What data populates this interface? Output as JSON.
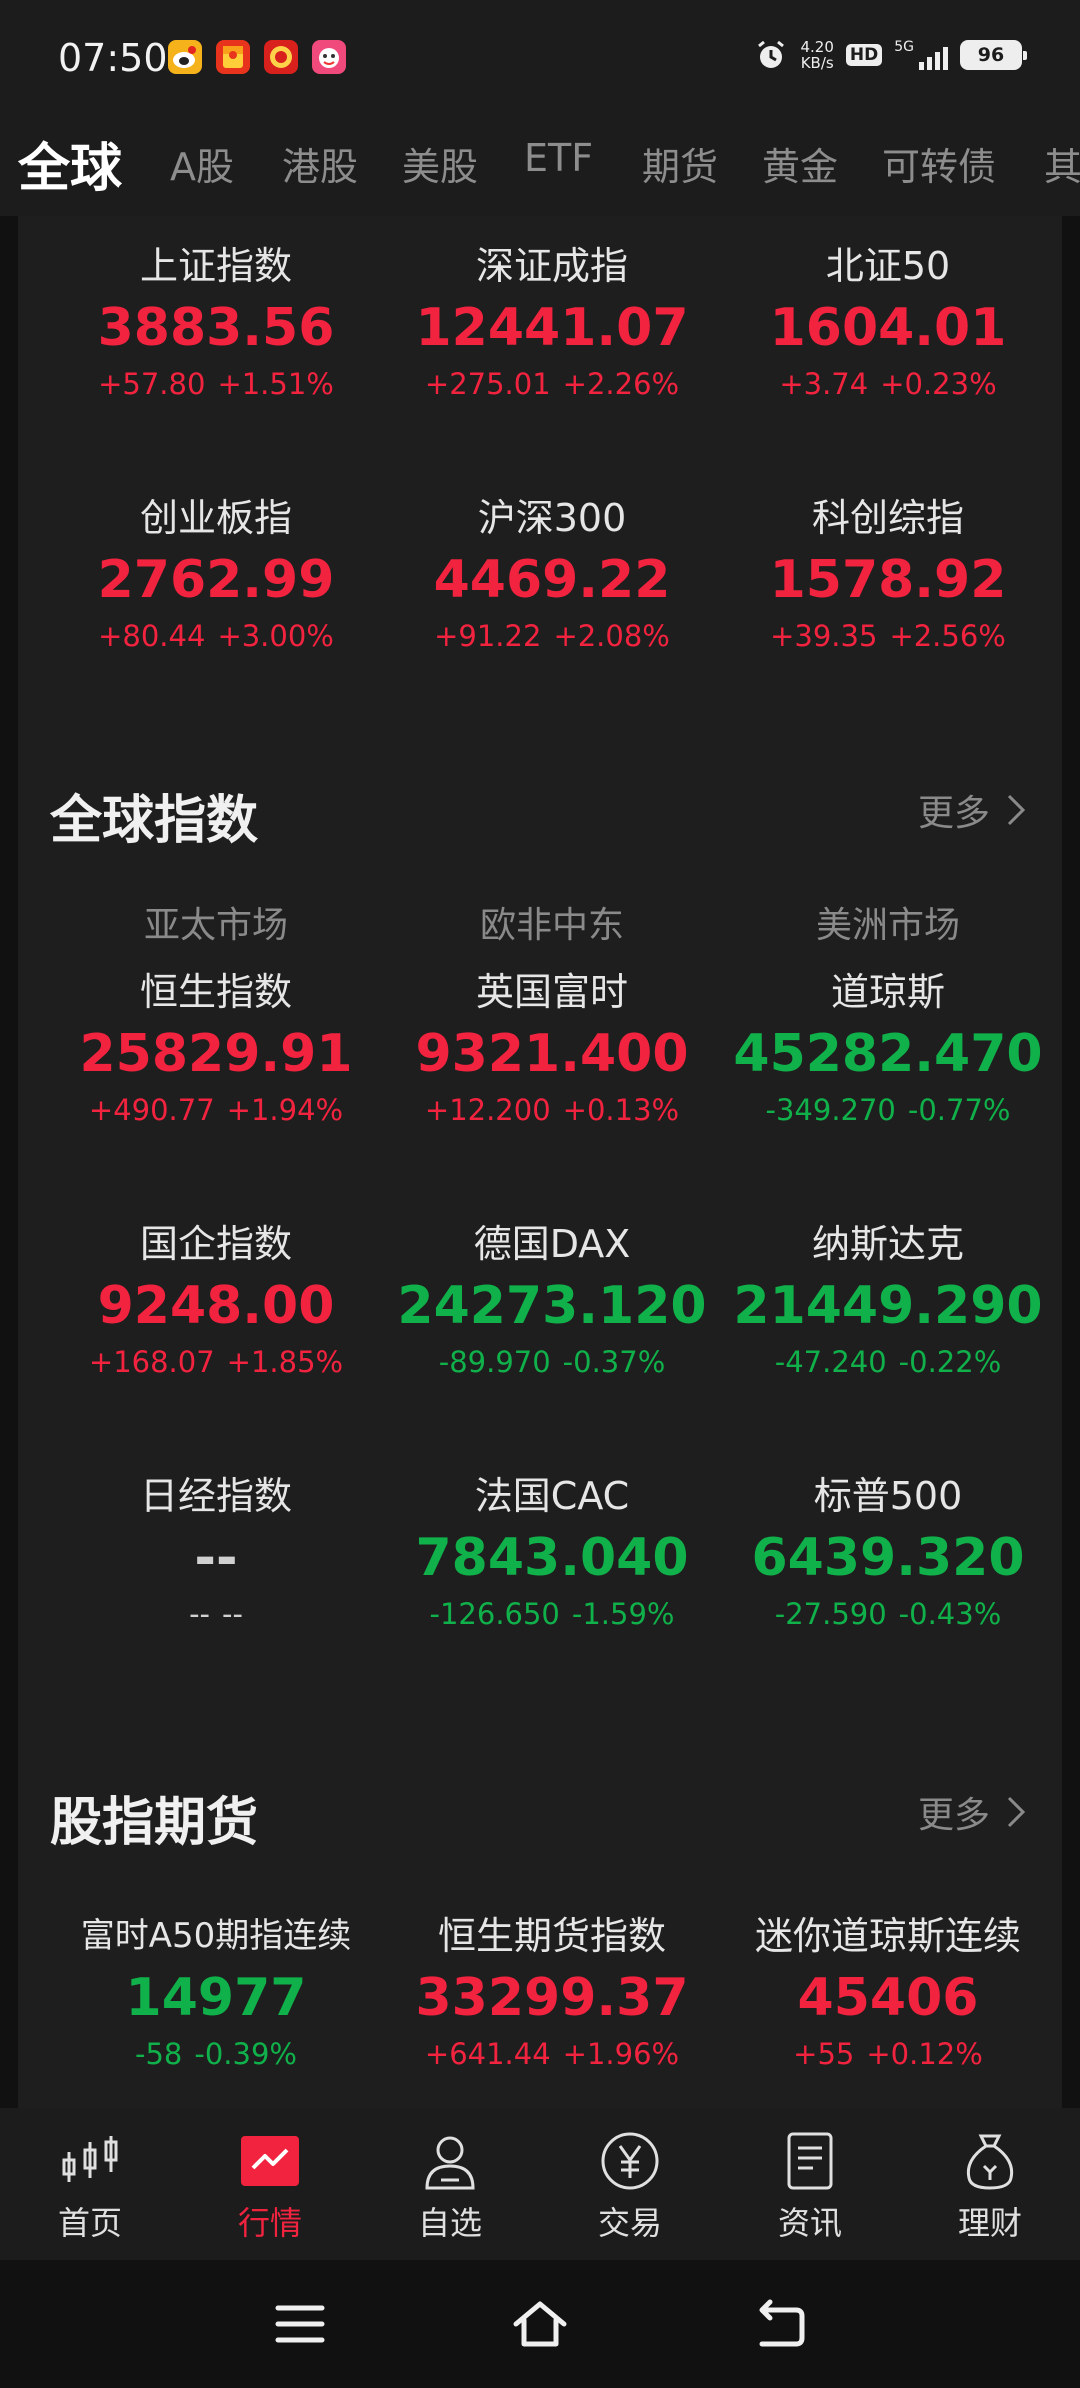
{
  "status_bar": {
    "time": "07:50",
    "net_speed_value": "4.20",
    "net_speed_unit": "KB/s",
    "hd": "HD",
    "network": "5G",
    "battery": "96"
  },
  "tabs": [
    "全球",
    "A股",
    "港股",
    "美股",
    "ETF",
    "期货",
    "黄金",
    "可转债",
    "其"
  ],
  "a_share_indices": [
    {
      "name": "上证指数",
      "price": "3883.56",
      "change": "+57.80",
      "pct": "+1.51%",
      "dir": "up"
    },
    {
      "name": "深证成指",
      "price": "12441.07",
      "change": "+275.01",
      "pct": "+2.26%",
      "dir": "up"
    },
    {
      "name": "北证50",
      "price": "1604.01",
      "change": "+3.74",
      "pct": "+0.23%",
      "dir": "up"
    },
    {
      "name": "创业板指",
      "price": "2762.99",
      "change": "+80.44",
      "pct": "+3.00%",
      "dir": "up"
    },
    {
      "name": "沪深300",
      "price": "4469.22",
      "change": "+91.22",
      "pct": "+2.08%",
      "dir": "up"
    },
    {
      "name": "科创综指",
      "price": "1578.92",
      "change": "+39.35",
      "pct": "+2.56%",
      "dir": "up"
    }
  ],
  "global_indices": {
    "title": "全球指数",
    "more": "更多",
    "regions": [
      "亚太市场",
      "欧非中东",
      "美洲市场"
    ],
    "items": [
      {
        "name": "恒生指数",
        "price": "25829.91",
        "change": "+490.77",
        "pct": "+1.94%",
        "dir": "up"
      },
      {
        "name": "英国富时",
        "price": "9321.400",
        "change": "+12.200",
        "pct": "+0.13%",
        "dir": "up"
      },
      {
        "name": "道琼斯",
        "price": "45282.470",
        "change": "-349.270",
        "pct": "-0.77%",
        "dir": "down"
      },
      {
        "name": "国企指数",
        "price": "9248.00",
        "change": "+168.07",
        "pct": "+1.85%",
        "dir": "up"
      },
      {
        "name": "德国DAX",
        "price": "24273.120",
        "change": "-89.970",
        "pct": "-0.37%",
        "dir": "down"
      },
      {
        "name": "纳斯达克",
        "price": "21449.290",
        "change": "-47.240",
        "pct": "-0.22%",
        "dir": "down"
      },
      {
        "name": "日经指数",
        "price": "--",
        "change": "--",
        "pct": "--",
        "dir": "flat"
      },
      {
        "name": "法国CAC",
        "price": "7843.040",
        "change": "-126.650",
        "pct": "-1.59%",
        "dir": "down"
      },
      {
        "name": "标普500",
        "price": "6439.320",
        "change": "-27.590",
        "pct": "-0.43%",
        "dir": "down"
      }
    ]
  },
  "index_futures": {
    "title": "股指期货",
    "more": "更多",
    "items": [
      {
        "name": "富时A50期指连续",
        "price": "14977",
        "change": "-58",
        "pct": "-0.39%",
        "dir": "down"
      },
      {
        "name": "恒生期货指数",
        "price": "33299.37",
        "change": "+641.44",
        "pct": "+1.96%",
        "dir": "up"
      },
      {
        "name": "迷你道琼斯连续",
        "price": "45406",
        "change": "+55",
        "pct": "+0.12%",
        "dir": "up"
      }
    ]
  },
  "bottom_nav": [
    {
      "label": "首页",
      "icon": "candlestick-icon"
    },
    {
      "label": "行情",
      "icon": "market-chart-icon",
      "active": true
    },
    {
      "label": "自选",
      "icon": "person-icon"
    },
    {
      "label": "交易",
      "icon": "yuan-icon"
    },
    {
      "label": "资讯",
      "icon": "document-icon"
    },
    {
      "label": "理财",
      "icon": "money-bag-icon"
    }
  ],
  "colors": {
    "up": "#f2233f",
    "down": "#10b04a",
    "background": "#111111",
    "card": "#1e1e1e"
  }
}
